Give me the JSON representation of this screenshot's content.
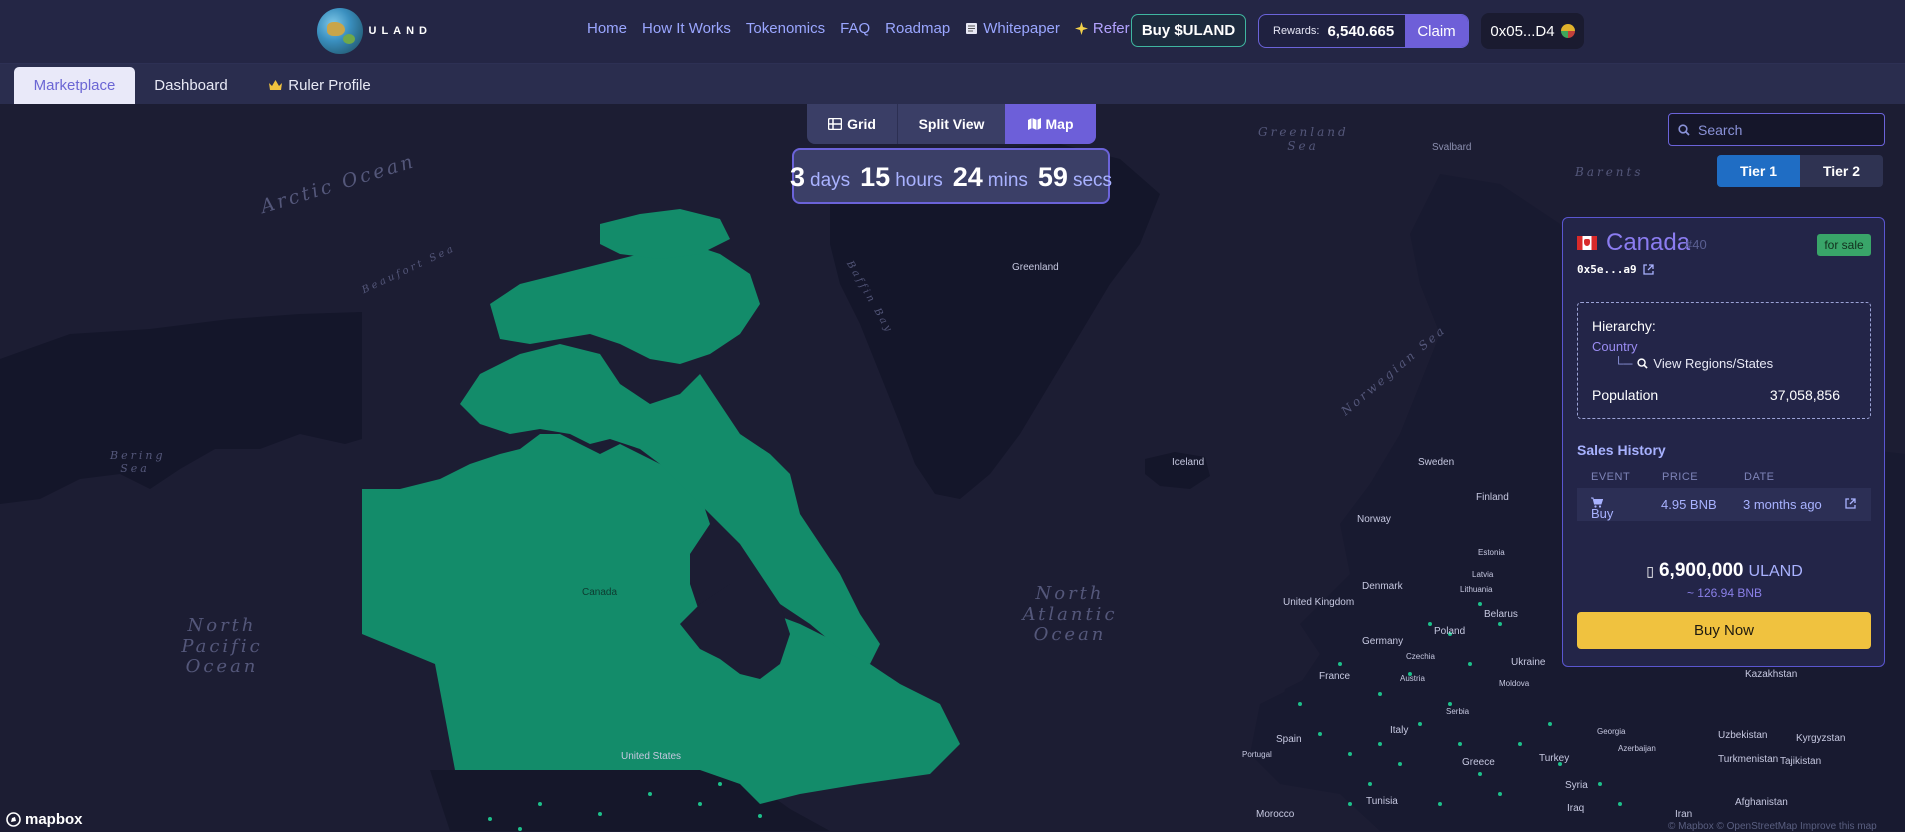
{
  "header": {
    "logo_text": "ULAND",
    "nav": [
      {
        "label": "Home"
      },
      {
        "label": "How It Works"
      },
      {
        "label": "Tokenomics"
      },
      {
        "label": "FAQ"
      },
      {
        "label": "Roadmap"
      },
      {
        "label": "Whitepaper",
        "icon": "document-icon"
      },
      {
        "label": "Refer",
        "icon": "sparkle-icon"
      }
    ],
    "buy_button": "Buy $ULAND",
    "rewards": {
      "label": "Rewards:",
      "value": "6,540.665",
      "claim": "Claim"
    },
    "wallet": {
      "address": "0x05...D4"
    }
  },
  "tabs": [
    {
      "label": "Marketplace",
      "active": true
    },
    {
      "label": "Dashboard"
    },
    {
      "label": "Ruler Profile",
      "icon": "crown-icon"
    }
  ],
  "view_toggle": {
    "grid": "Grid",
    "split": "Split View",
    "map": "Map",
    "active": "Map"
  },
  "countdown": {
    "days": "3",
    "days_unit": "days",
    "hours": "15",
    "hours_unit": "hours",
    "mins": "24",
    "mins_unit": "mins",
    "secs": "59",
    "secs_unit": "secs"
  },
  "search": {
    "placeholder": "Search"
  },
  "tiers": [
    {
      "label": "Tier 1",
      "active": true
    },
    {
      "label": "Tier 2"
    }
  ],
  "card": {
    "country": "Canada",
    "rank": "#40",
    "badge": "for sale",
    "owner": "0x5e...a9",
    "hierarchy_label": "Hierarchy:",
    "hierarchy_level": "Country",
    "view_regions": "View Regions/States",
    "population_label": "Population",
    "population_value": "37,058,856",
    "sales_title": "Sales History",
    "sales_headers": [
      "EVENT",
      "PRICE",
      "DATE"
    ],
    "sales": [
      {
        "event": "Buy",
        "price": "4.95 BNB",
        "date": "3 months ago"
      }
    ],
    "price_value": "6,900,000",
    "price_unit": "ULAND",
    "price_bnb": "~ 126.94 BNB",
    "buy_button": "Buy Now"
  },
  "map": {
    "labels": {
      "arctic": "Arctic Ocean",
      "greenland_sea": "Greenland Sea",
      "north_atlantic": "North Atlantic Ocean",
      "north_pacific": "North Pacific Ocean",
      "bering": "Bering Sea",
      "beaufort": "Beaufort Sea",
      "baffin": "Baffin Bay",
      "norwegian": "Norwegian Sea",
      "barents": "Barents",
      "svalbard": "Svalbard",
      "greenland": "Greenland",
      "iceland": "Iceland",
      "canada": "Canada",
      "united_states": "United States",
      "sweden": "Sweden",
      "finland": "Finland",
      "norway": "Norway",
      "estonia": "Estonia",
      "latvia": "Latvia",
      "lithuania": "Lithuania",
      "denmark": "Denmark",
      "united_kingdom": "United Kingdom",
      "belarus": "Belarus",
      "germany": "Germany",
      "poland": "Poland",
      "czechia": "Czechia",
      "ukraine": "Ukraine",
      "moldova": "Moldova",
      "kazakhstan": "Kazakhstan",
      "austria": "Austria",
      "france": "France",
      "serbia": "Serbia",
      "italy": "Italy",
      "spain": "Spain",
      "portugal": "Portugal",
      "greece": "Greece",
      "turkey": "Turkey",
      "georgia": "Georgia",
      "azerbaijan": "Azerbaijan",
      "uzbekistan": "Uzbekistan",
      "kyrgyzstan": "Kyrgyzstan",
      "turkmenistan": "Turkmenistan",
      "tajikistan": "Tajikistan",
      "syria": "Syria",
      "tunisia": "Tunisia",
      "iraq": "Iraq",
      "iran": "Iran",
      "afghanistan": "Afghanistan",
      "morocco": "Morocco"
    },
    "mapbox": "mapbox",
    "attribution": "© Mapbox © OpenStreetMap Improve this map",
    "colors": {
      "selected": "#138c6a",
      "land": "#15172a",
      "water": "#1c1d33",
      "dots": "#1dbf8a"
    }
  }
}
